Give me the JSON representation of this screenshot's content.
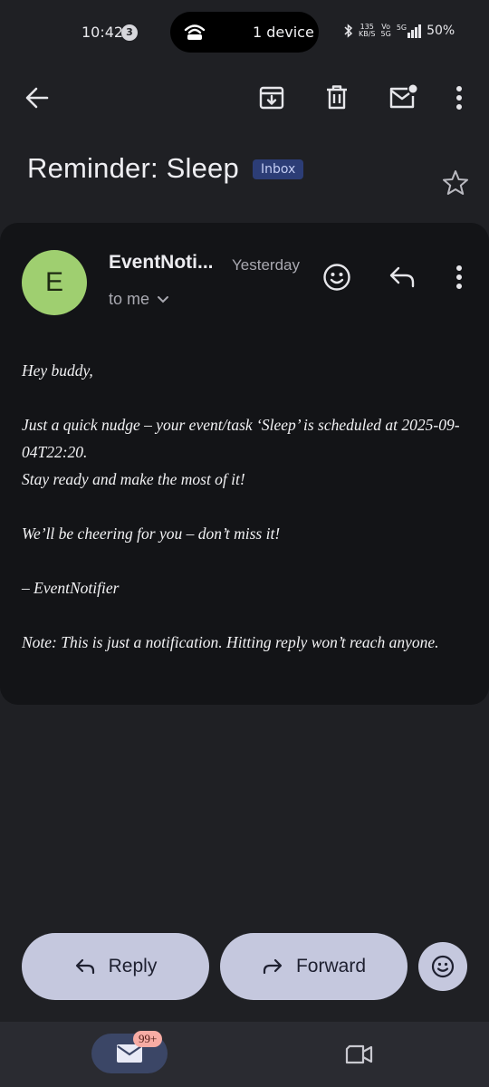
{
  "status_bar": {
    "time": "10:42",
    "notification_count": "3",
    "island_text": "1 device",
    "net_speed_top": "135",
    "net_speed_bottom": "KB/S",
    "volte_top": "Vo",
    "volte_bottom": "5G",
    "network": "5G",
    "battery": "50%"
  },
  "toolbar": {
    "icons": [
      "back-arrow-icon",
      "archive-icon",
      "delete-icon",
      "mark-unread-icon",
      "more-vert-icon"
    ]
  },
  "email": {
    "subject": "Reminder: Sleep",
    "label": "Inbox",
    "sender_initial": "E",
    "sender": "EventNoti...",
    "time": "Yesterday",
    "recipient": "to me",
    "body": {
      "greeting": "Hey buddy,",
      "line1": "Just a quick nudge – your event/task ‘Sleep’ is scheduled at 2025-09-04T22:20.",
      "line2": "Stay ready and make the most of it!",
      "line3": "We’ll be cheering for you – don’t miss it!",
      "signature": "– EventNotifier",
      "note": "Note: This is just a notification. Hitting reply won’t reach anyone."
    }
  },
  "actions": {
    "reply_label": "Reply",
    "forward_label": "Forward"
  },
  "bottom_nav": {
    "mail_badge": "99+"
  },
  "colors": {
    "background": "#1f2024",
    "card": "#131417",
    "avatar": "#9fcf70",
    "button": "#c5c8de",
    "label_chip": "#2c3d76",
    "badge": "#f7aca4"
  }
}
